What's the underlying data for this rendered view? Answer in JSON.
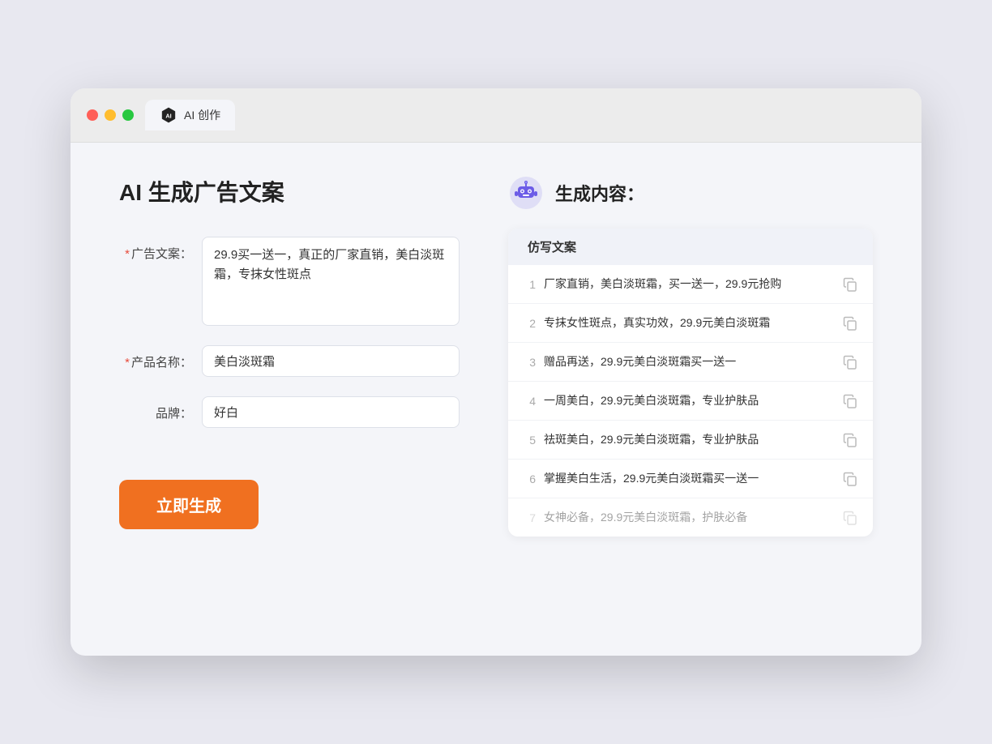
{
  "browser": {
    "tab_label": "AI 创作"
  },
  "page": {
    "title": "AI 生成广告文案",
    "result_heading": "生成内容："
  },
  "form": {
    "ad_copy_label": "广告文案：",
    "ad_copy_required": "*",
    "ad_copy_value": "29.9买一送一，真正的厂家直销，美白淡斑霜，专抹女性斑点",
    "product_name_label": "产品名称：",
    "product_name_required": "*",
    "product_name_value": "美白淡斑霜",
    "brand_label": "品牌：",
    "brand_value": "好白",
    "generate_button": "立即生成"
  },
  "results": {
    "column_header": "仿写文案",
    "items": [
      {
        "num": "1",
        "text": "厂家直销，美白淡斑霜，买一送一，29.9元抢购",
        "faded": false
      },
      {
        "num": "2",
        "text": "专抹女性斑点，真实功效，29.9元美白淡斑霜",
        "faded": false
      },
      {
        "num": "3",
        "text": "赠品再送，29.9元美白淡斑霜买一送一",
        "faded": false
      },
      {
        "num": "4",
        "text": "一周美白，29.9元美白淡斑霜，专业护肤品",
        "faded": false
      },
      {
        "num": "5",
        "text": "祛斑美白，29.9元美白淡斑霜，专业护肤品",
        "faded": false
      },
      {
        "num": "6",
        "text": "掌握美白生活，29.9元美白淡斑霜买一送一",
        "faded": false
      },
      {
        "num": "7",
        "text": "女神必备，29.9元美白淡斑霜，护肤必备",
        "faded": true
      }
    ]
  }
}
